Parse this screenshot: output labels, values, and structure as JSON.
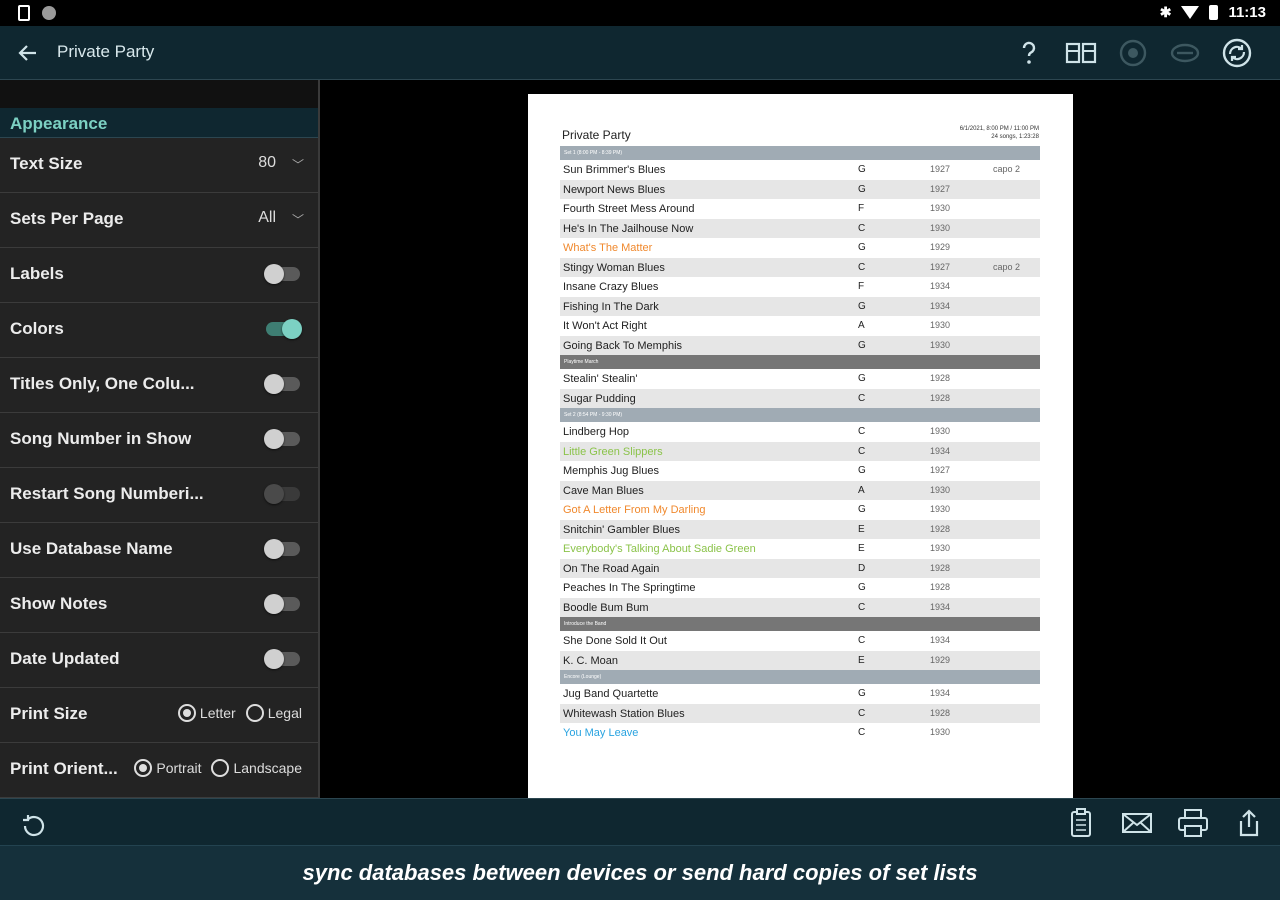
{
  "status_bar": {
    "time": "11:13"
  },
  "app_bar": {
    "title": "Private Party"
  },
  "sidebar": {
    "section_header": "Appearance",
    "text_size": {
      "label": "Text Size",
      "value": "80"
    },
    "sets_per_page": {
      "label": "Sets Per Page",
      "value": "All"
    },
    "toggles": [
      {
        "label": "Labels",
        "on": false,
        "disabled": false
      },
      {
        "label": "Colors",
        "on": true,
        "disabled": false
      },
      {
        "label": "Titles Only, One Colu...",
        "on": false,
        "disabled": false
      },
      {
        "label": "Song Number in Show",
        "on": false,
        "disabled": false
      },
      {
        "label": "Restart Song Numberi...",
        "on": false,
        "disabled": true
      },
      {
        "label": "Use Database Name",
        "on": false,
        "disabled": false
      },
      {
        "label": "Show Notes",
        "on": false,
        "disabled": false
      },
      {
        "label": "Date Updated",
        "on": false,
        "disabled": false
      }
    ],
    "print_size": {
      "label": "Print Size",
      "options": [
        "Letter",
        "Legal"
      ],
      "selected": "Letter"
    },
    "print_orientation": {
      "label": "Print Orient...",
      "options": [
        "Portrait",
        "Landscape"
      ],
      "selected": "Portrait"
    }
  },
  "document": {
    "title": "Private Party",
    "meta_line1": "6/1/2021, 8:00 PM / 11:00 PM",
    "meta_line2": "24 songs, 1:23:28",
    "colors": {
      "orange": "#f0892e",
      "green": "#8bc34a",
      "blue": "#29a3e0",
      "default": "#222222"
    },
    "items": [
      {
        "type": "header",
        "style": "light",
        "text": "Set 1 (8:00 PM - 8:39 PM)"
      },
      {
        "type": "song",
        "title": "Sun Brimmer's Blues",
        "key": "G",
        "year": "1927",
        "note": "capo 2",
        "color": "default"
      },
      {
        "type": "song",
        "title": "Newport News Blues",
        "key": "G",
        "year": "1927",
        "note": "",
        "color": "default"
      },
      {
        "type": "song",
        "title": "Fourth Street Mess Around",
        "key": "F",
        "year": "1930",
        "note": "",
        "color": "default"
      },
      {
        "type": "song",
        "title": "He's In The Jailhouse Now",
        "key": "C",
        "year": "1930",
        "note": "",
        "color": "default"
      },
      {
        "type": "song",
        "title": "What's The Matter",
        "key": "G",
        "year": "1929",
        "note": "",
        "color": "orange"
      },
      {
        "type": "song",
        "title": "Stingy Woman Blues",
        "key": "C",
        "year": "1927",
        "note": "capo 2",
        "color": "default"
      },
      {
        "type": "song",
        "title": "Insane Crazy Blues",
        "key": "F",
        "year": "1934",
        "note": "",
        "color": "default"
      },
      {
        "type": "song",
        "title": "Fishing In The Dark",
        "key": "G",
        "year": "1934",
        "note": "",
        "color": "default"
      },
      {
        "type": "song",
        "title": "It Won't Act Right",
        "key": "A",
        "year": "1930",
        "note": "",
        "color": "default"
      },
      {
        "type": "song",
        "title": "Going Back To Memphis",
        "key": "G",
        "year": "1930",
        "note": "",
        "color": "default"
      },
      {
        "type": "header",
        "style": "dark",
        "text": "Playtime March"
      },
      {
        "type": "song",
        "title": "Stealin' Stealin'",
        "key": "G",
        "year": "1928",
        "note": "",
        "color": "default"
      },
      {
        "type": "song",
        "title": "Sugar Pudding",
        "key": "C",
        "year": "1928",
        "note": "",
        "color": "default"
      },
      {
        "type": "header",
        "style": "light",
        "text": "Set 2 (8:54 PM - 9:30 PM)"
      },
      {
        "type": "song",
        "title": "Lindberg Hop",
        "key": "C",
        "year": "1930",
        "note": "",
        "color": "default"
      },
      {
        "type": "song",
        "title": "Little Green Slippers",
        "key": "C",
        "year": "1934",
        "note": "",
        "color": "green"
      },
      {
        "type": "song",
        "title": "Memphis Jug Blues",
        "key": "G",
        "year": "1927",
        "note": "",
        "color": "default"
      },
      {
        "type": "song",
        "title": "Cave Man Blues",
        "key": "A",
        "year": "1930",
        "note": "",
        "color": "default"
      },
      {
        "type": "song",
        "title": "Got A Letter From My Darling",
        "key": "G",
        "year": "1930",
        "note": "",
        "color": "orange"
      },
      {
        "type": "song",
        "title": "Snitchin' Gambler Blues",
        "key": "E",
        "year": "1928",
        "note": "",
        "color": "default"
      },
      {
        "type": "song",
        "title": "Everybody's Talking About Sadie Green",
        "key": "E",
        "year": "1930",
        "note": "",
        "color": "green"
      },
      {
        "type": "song",
        "title": "On The Road Again",
        "key": "D",
        "year": "1928",
        "note": "",
        "color": "default"
      },
      {
        "type": "song",
        "title": "Peaches In The Springtime",
        "key": "G",
        "year": "1928",
        "note": "",
        "color": "default"
      },
      {
        "type": "song",
        "title": "Boodle Bum Bum",
        "key": "C",
        "year": "1934",
        "note": "",
        "color": "default"
      },
      {
        "type": "header",
        "style": "dark",
        "text": "Introduce the Band"
      },
      {
        "type": "song",
        "title": "She Done Sold It Out",
        "key": "C",
        "year": "1934",
        "note": "",
        "color": "default"
      },
      {
        "type": "song",
        "title": "K. C. Moan",
        "key": "E",
        "year": "1929",
        "note": "",
        "color": "default"
      },
      {
        "type": "header",
        "style": "light",
        "text": "Encore (Lounge)"
      },
      {
        "type": "song",
        "title": "Jug Band Quartette",
        "key": "G",
        "year": "1934",
        "note": "",
        "color": "default"
      },
      {
        "type": "song",
        "title": "Whitewash Station Blues",
        "key": "C",
        "year": "1928",
        "note": "",
        "color": "default"
      },
      {
        "type": "song",
        "title": "You May Leave",
        "key": "C",
        "year": "1930",
        "note": "",
        "color": "blue"
      }
    ]
  },
  "caption": "sync databases between devices or send hard copies of set lists"
}
